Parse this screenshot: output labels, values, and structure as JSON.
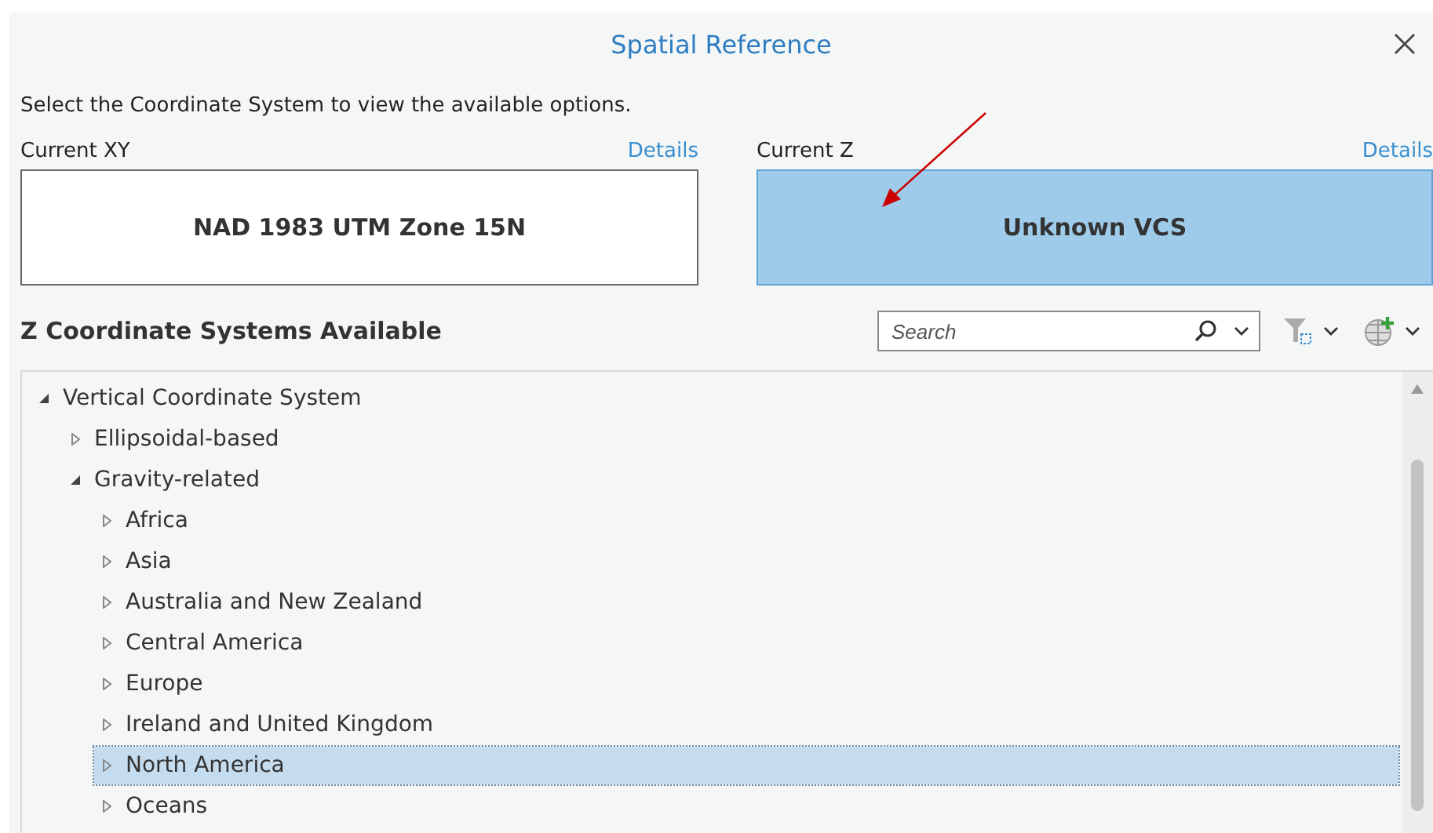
{
  "window": {
    "title": "Spatial Reference"
  },
  "instruction": "Select the Coordinate System to view the available options.",
  "current": [
    {
      "label": "Current XY",
      "link": "Details",
      "value": "NAD 1983 UTM Zone 15N",
      "selected": false
    },
    {
      "label": "Current Z",
      "link": "Details",
      "value": "Unknown VCS",
      "selected": true
    }
  ],
  "available": {
    "title": "Z Coordinate Systems Available",
    "search": {
      "placeholder": "Search"
    }
  },
  "tree": [
    {
      "label": "Vertical Coordinate System",
      "expanded": true,
      "selected": false,
      "children": [
        {
          "label": "Ellipsoidal-based",
          "expanded": false,
          "selected": false
        },
        {
          "label": "Gravity-related",
          "expanded": true,
          "selected": false,
          "children": [
            {
              "label": "Africa",
              "expanded": false,
              "selected": false
            },
            {
              "label": "Asia",
              "expanded": false,
              "selected": false
            },
            {
              "label": "Australia and New Zealand",
              "expanded": false,
              "selected": false
            },
            {
              "label": "Central America",
              "expanded": false,
              "selected": false
            },
            {
              "label": "Europe",
              "expanded": false,
              "selected": false
            },
            {
              "label": "Ireland and United Kingdom",
              "expanded": false,
              "selected": false
            },
            {
              "label": "North America",
              "expanded": false,
              "selected": true
            },
            {
              "label": "Oceans",
              "expanded": false,
              "selected": false
            }
          ]
        }
      ]
    }
  ]
}
